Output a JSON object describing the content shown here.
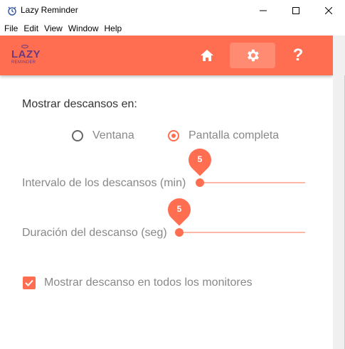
{
  "window": {
    "title": "Lazy Reminder"
  },
  "menu": [
    "File",
    "Edit",
    "View",
    "Window",
    "Help"
  ],
  "brand": {
    "logo_top": "LAZY",
    "logo_bottom": "REMINDER"
  },
  "nav": {
    "help_label": "?"
  },
  "settings": {
    "display_label": "Mostrar descansos en:",
    "options": [
      {
        "label": "Ventana",
        "selected": false
      },
      {
        "label": "Pantalla completa",
        "selected": true
      }
    ],
    "interval": {
      "label": "Intervalo de los descansos (min)",
      "value": "5"
    },
    "duration": {
      "label": "Duración del descanso (seg)",
      "value": "5"
    },
    "all_monitors": {
      "label": "Mostrar descanso en todos los monitores",
      "checked": true
    }
  },
  "colors": {
    "accent": "#ff6e51",
    "logo": "#6b3a7d"
  }
}
